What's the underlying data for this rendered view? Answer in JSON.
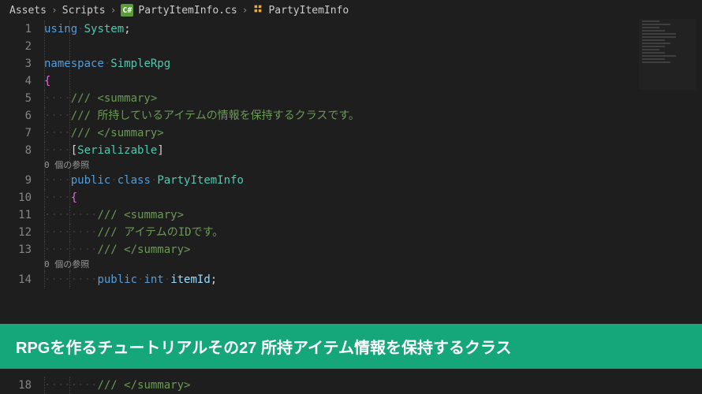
{
  "breadcrumb": {
    "parts": [
      "Assets",
      "Scripts",
      "PartyItemInfo.cs",
      "PartyItemInfo"
    ],
    "csharp_badge": "C#"
  },
  "code": {
    "lines": [
      {
        "num": "1",
        "tokens": [
          {
            "t": "using",
            "c": "keyword"
          },
          {
            "t": " ",
            "c": "ws"
          },
          {
            "t": "System",
            "c": "namespace"
          },
          {
            "t": ";",
            "c": "punct"
          }
        ]
      },
      {
        "num": "2",
        "tokens": []
      },
      {
        "num": "3",
        "tokens": [
          {
            "t": "namespace",
            "c": "keyword"
          },
          {
            "t": " ",
            "c": "ws"
          },
          {
            "t": "SimpleRpg",
            "c": "namespace"
          }
        ]
      },
      {
        "num": "4",
        "tokens": [
          {
            "t": "{",
            "c": "bracket"
          }
        ]
      },
      {
        "num": "5",
        "indent": 1,
        "tokens": [
          {
            "t": "/// <summary>",
            "c": "comment"
          }
        ]
      },
      {
        "num": "6",
        "indent": 1,
        "tokens": [
          {
            "t": "/// 所持しているアイテムの情報を保持するクラスです。",
            "c": "comment"
          }
        ]
      },
      {
        "num": "7",
        "indent": 1,
        "tokens": [
          {
            "t": "/// </summary>",
            "c": "comment"
          }
        ]
      },
      {
        "num": "8",
        "indent": 1,
        "tokens": [
          {
            "t": "[",
            "c": "punct"
          },
          {
            "t": "Serializable",
            "c": "attribute"
          },
          {
            "t": "]",
            "c": "punct"
          }
        ]
      },
      {
        "num": "",
        "codelens": true,
        "indent": 1,
        "text": "0 個の参照"
      },
      {
        "num": "9",
        "indent": 1,
        "tokens": [
          {
            "t": "public",
            "c": "keyword"
          },
          {
            "t": " ",
            "c": "ws"
          },
          {
            "t": "class",
            "c": "keyword"
          },
          {
            "t": " ",
            "c": "ws"
          },
          {
            "t": "PartyItemInfo",
            "c": "type"
          }
        ]
      },
      {
        "num": "10",
        "indent": 1,
        "tokens": [
          {
            "t": "{",
            "c": "bracket"
          }
        ]
      },
      {
        "num": "11",
        "indent": 2,
        "tokens": [
          {
            "t": "/// <summary>",
            "c": "comment"
          }
        ]
      },
      {
        "num": "12",
        "indent": 2,
        "tokens": [
          {
            "t": "/// アイテムのIDです。",
            "c": "comment"
          }
        ]
      },
      {
        "num": "13",
        "indent": 2,
        "tokens": [
          {
            "t": "/// </summary>",
            "c": "comment"
          }
        ]
      },
      {
        "num": "",
        "codelens": true,
        "indent": 2,
        "text": "0 個の参照"
      },
      {
        "num": "14",
        "indent": 2,
        "tokens": [
          {
            "t": "public",
            "c": "keyword"
          },
          {
            "t": " ",
            "c": "ws"
          },
          {
            "t": "int",
            "c": "keyword"
          },
          {
            "t": " ",
            "c": "ws"
          },
          {
            "t": "itemId",
            "c": "field"
          },
          {
            "t": ";",
            "c": "punct"
          }
        ]
      }
    ],
    "bottom_line": {
      "num": "18",
      "indent": 2,
      "tokens": [
        {
          "t": "/// </summary>",
          "c": "comment"
        }
      ]
    }
  },
  "banner": {
    "text": "RPGを作るチュートリアルその27 所持アイテム情報を保持するクラス"
  }
}
